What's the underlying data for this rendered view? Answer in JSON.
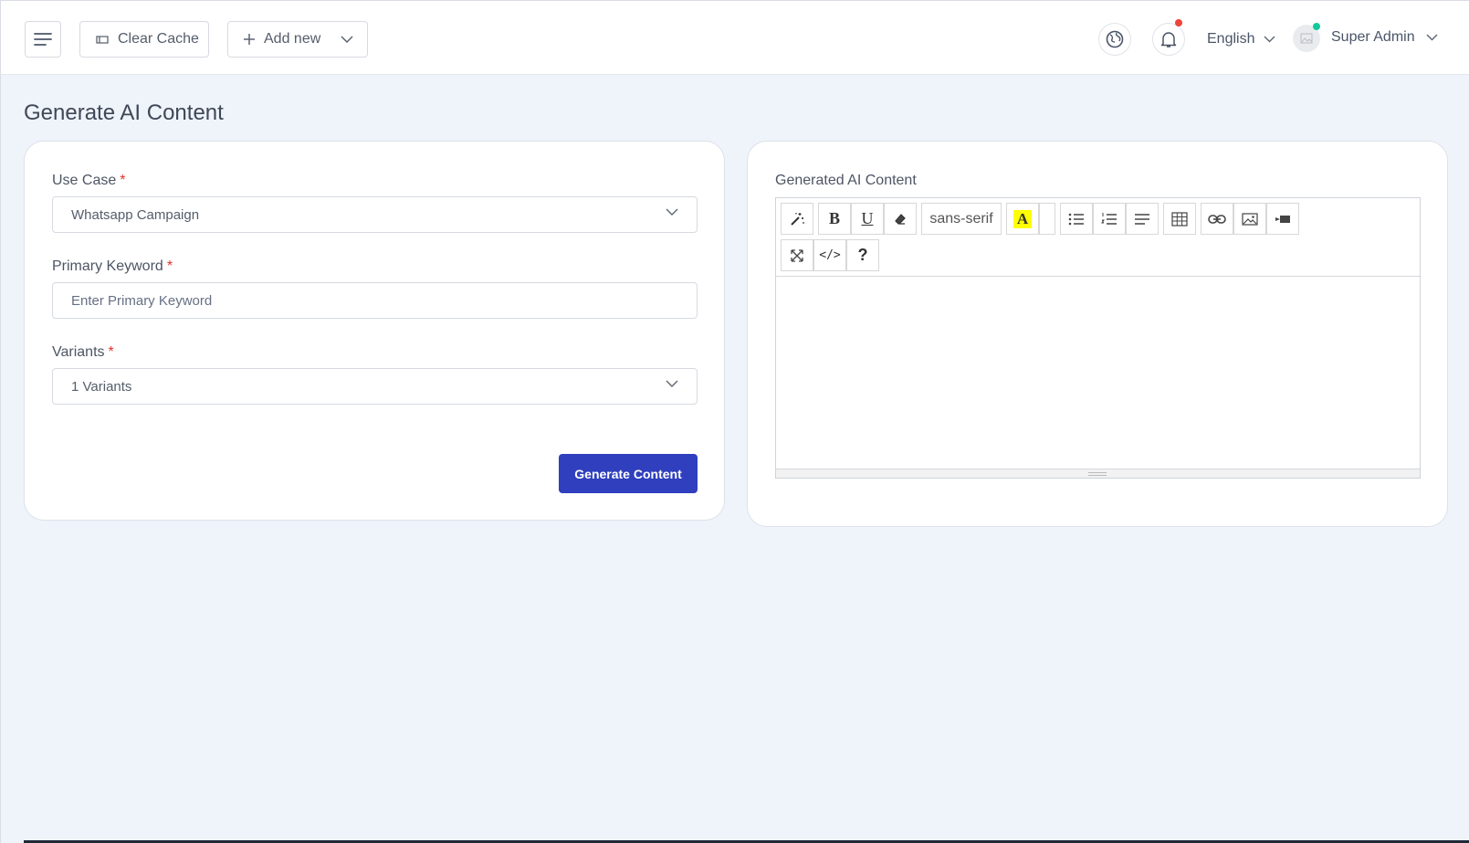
{
  "header": {
    "clear_cache_label": "Clear Cache",
    "add_new_label": "Add new",
    "language": "English",
    "user_name": "Super Admin"
  },
  "page": {
    "title": "Generate AI Content"
  },
  "form": {
    "use_case_label": "Use Case",
    "use_case_value": "Whatsapp Campaign",
    "primary_keyword_label": "Primary Keyword",
    "primary_keyword_placeholder": "Enter Primary Keyword",
    "variants_label": "Variants",
    "variants_value": "1 Variants",
    "required_mark": "*",
    "generate_button": "Generate Content"
  },
  "editor": {
    "label": "Generated AI Content",
    "font_name": "sans-serif",
    "bold_glyph": "B",
    "underline_glyph": "U",
    "color_glyph": "A",
    "code_glyph": "</>",
    "help_glyph": "?"
  },
  "colors": {
    "accent": "#2f3fbe",
    "required": "#e5322d",
    "notification_dot": "#f04438",
    "online_dot": "#12c99b",
    "page_bg": "#eff3fa",
    "highlight_yellow": "#ffff00"
  }
}
